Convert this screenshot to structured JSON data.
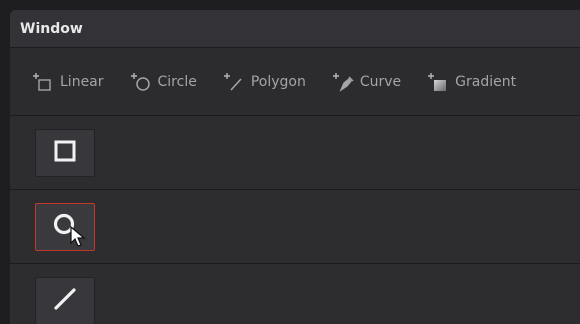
{
  "window": {
    "title": "Window"
  },
  "toolbar": {
    "tools": [
      {
        "label": "Linear",
        "icon": "linear-gradient-plus-icon"
      },
      {
        "label": "Circle",
        "icon": "circle-plus-icon"
      },
      {
        "label": "Polygon",
        "icon": "polygon-plus-icon"
      },
      {
        "label": "Curve",
        "icon": "curve-pen-plus-icon"
      },
      {
        "label": "Gradient",
        "icon": "gradient-plus-icon"
      }
    ]
  },
  "shapes": [
    {
      "icon": "square-icon",
      "selected": false
    },
    {
      "icon": "circle-icon",
      "selected": true
    },
    {
      "icon": "line-icon",
      "selected": false
    }
  ],
  "colors": {
    "accent_selected_border": "#c0392b",
    "text_primary": "#e8e8e8",
    "text_muted": "#a3a3a8"
  }
}
